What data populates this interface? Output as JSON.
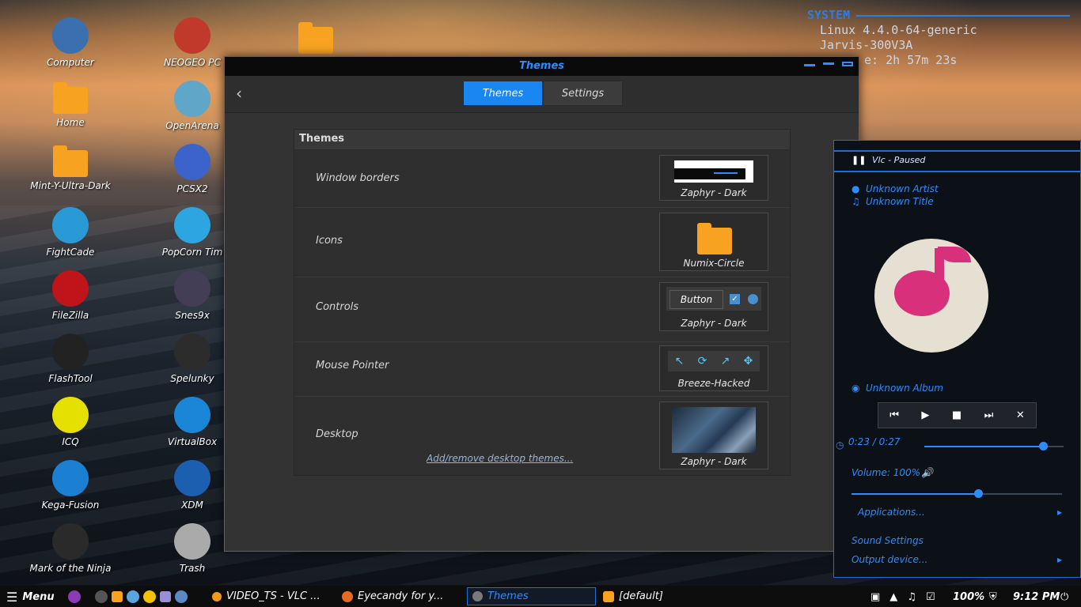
{
  "desktop_icons": [
    {
      "label": "Computer",
      "color": "#3a6fb0"
    },
    {
      "label": "NEOGEO PC",
      "color": "#c0392b"
    },
    {
      "label": "Home",
      "color": "#f7a321"
    },
    {
      "label": "OpenArena",
      "color": "#5fa6c9"
    },
    {
      "label": "Mint-Y-Ultra-Dark",
      "color": "#f7a321"
    },
    {
      "label": "PCSX2",
      "color": "#3b63c9"
    },
    {
      "label": "FightCade",
      "color": "#2a9ad6"
    },
    {
      "label": "PopCorn Tim",
      "color": "#2da5e0"
    },
    {
      "label": "FileZilla",
      "color": "#c0141b"
    },
    {
      "label": "Snes9x",
      "color": "#433e55"
    },
    {
      "label": "FlashTool",
      "color": "#222"
    },
    {
      "label": "Spelunky",
      "color": "#2c2c2c"
    },
    {
      "label": "ICQ",
      "color": "#e6e000"
    },
    {
      "label": "VirtualBox",
      "color": "#1b86d6"
    },
    {
      "label": "Kega-Fusion",
      "color": "#1b7fd2"
    },
    {
      "label": "XDM",
      "color": "#1b5fb0"
    },
    {
      "label": "Mark of the Ninja",
      "color": "#2a2a2a"
    },
    {
      "label": "Trash",
      "color": "#aaaaaa"
    }
  ],
  "conky": {
    "heading": "SYSTEM",
    "kernel": "Linux 4.4.0-64-generic",
    "host": "Jarvis-300V3A",
    "uptime": "e: 2h 57m 23s"
  },
  "window": {
    "title": "Themes",
    "tabs": [
      {
        "label": "Themes"
      },
      {
        "label": "Settings"
      }
    ],
    "panel_title": "Themes",
    "rows": [
      {
        "label": "Window borders",
        "value": "Zaphyr - Dark"
      },
      {
        "label": "Icons",
        "value": "Numix-Circle"
      },
      {
        "label": "Controls",
        "value": "Zaphyr - Dark",
        "button_preview": "Button"
      },
      {
        "label": "Mouse Pointer",
        "value": "Breeze-Hacked"
      },
      {
        "label": "Desktop",
        "value": "Zaphyr - Dark"
      }
    ],
    "link": "Add/remove desktop themes..."
  },
  "sound": {
    "player": "Vlc - Paused",
    "artist": "Unknown Artist",
    "title": "Unknown Title",
    "album": "Unknown Album",
    "time": "0:23 / 0:27",
    "progress": 0.85,
    "volume_label": "Volume: 100%",
    "volume": 0.6,
    "applications": "Applications...",
    "settings": "Sound Settings",
    "output": "Output device..."
  },
  "taskbar": {
    "menu": "Menu",
    "tasks": [
      {
        "label": "VIDEO_TS - VLC ..."
      },
      {
        "label": "Eyecandy for y..."
      },
      {
        "label": "Themes"
      },
      {
        "label": "[default]"
      }
    ],
    "battery": "100%",
    "clock": "9:12 PM"
  }
}
